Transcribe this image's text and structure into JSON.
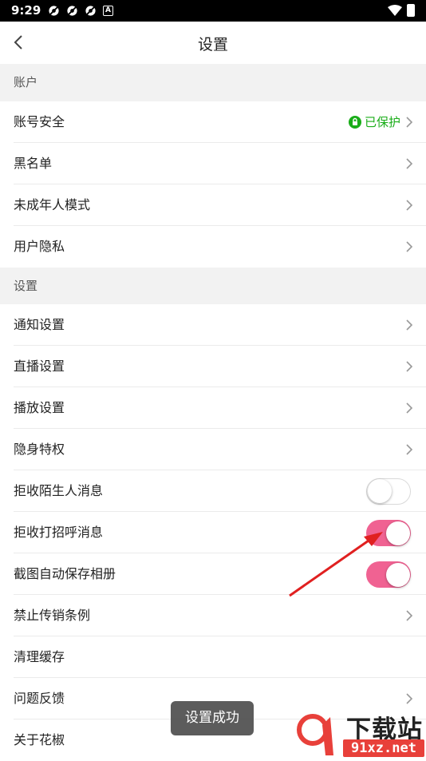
{
  "status_bar": {
    "time": "9:29",
    "notif_icons": [
      "gear-icon",
      "gear-icon",
      "gear-icon",
      "a-icon"
    ]
  },
  "nav": {
    "title": "设置"
  },
  "sections": [
    {
      "title": "账户",
      "items": [
        {
          "label": "账号安全",
          "status": "已保护",
          "chevron": true
        },
        {
          "label": "黑名单",
          "chevron": true
        },
        {
          "label": "未成年人模式",
          "chevron": true
        },
        {
          "label": "用户隐私",
          "chevron": true
        }
      ]
    },
    {
      "title": "设置",
      "items": [
        {
          "label": "通知设置",
          "chevron": true
        },
        {
          "label": "直播设置",
          "chevron": true
        },
        {
          "label": "播放设置",
          "chevron": true
        },
        {
          "label": "隐身特权",
          "chevron": true
        },
        {
          "label": "拒收陌生人消息",
          "toggle": "off"
        },
        {
          "label": "拒收打招呼消息",
          "toggle": "on"
        },
        {
          "label": "截图自动保存相册",
          "toggle": "on"
        },
        {
          "label": "禁止传销条例",
          "chevron": true
        },
        {
          "label": "清理缓存"
        },
        {
          "label": "问题反馈",
          "chevron": true
        },
        {
          "label": "关于花椒"
        }
      ]
    }
  ],
  "toast": {
    "text": "设置成功"
  },
  "watermark": {
    "top_text": "下载站",
    "bottom_text": "91xz.net"
  },
  "colors": {
    "toggle_on": "#f06292",
    "protected_green": "#1aad19",
    "arrow": "#e02020"
  }
}
